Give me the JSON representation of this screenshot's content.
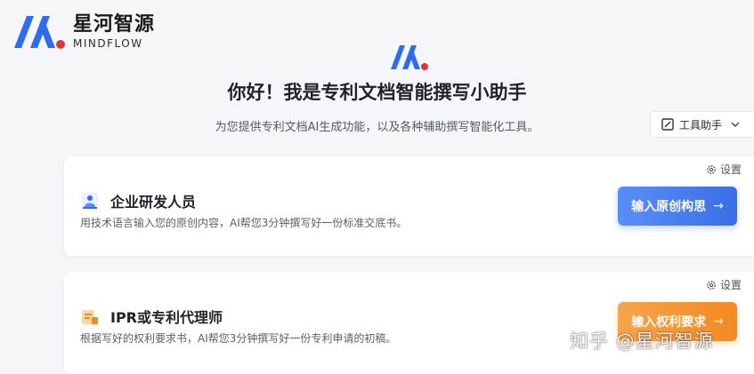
{
  "brand": {
    "name_cn": "星河智源",
    "name_en": "MINDFLOW"
  },
  "hero": {
    "headline": "你好！我是专利文档智能撰写小助手",
    "subtitle": "为您提供专利文档AI生成功能，以及各种辅助撰写智能化工具。"
  },
  "toolbar": {
    "tools_label": "工具助手"
  },
  "cards": [
    {
      "title": "企业研发人员",
      "desc": "用技术语言输入您的原创内容，AI帮您3分钟撰写好一份标准交底书。",
      "button": "输入原创构思",
      "settings": "设置",
      "icon": "researcher-icon"
    },
    {
      "title": "IPR或专利代理师",
      "desc": "根据写好的权利要求书，AI帮您3分钟撰写好一份专利申请的初稿。",
      "button": "输入权利要求",
      "settings": "设置",
      "icon": "attorney-icon"
    }
  ],
  "arrow": "→",
  "watermark": "知乎 @星河智源",
  "colors": {
    "brand_blue": "#2f6bf0",
    "brand_red": "#e0343a",
    "accent_orange": "#f28a22"
  }
}
